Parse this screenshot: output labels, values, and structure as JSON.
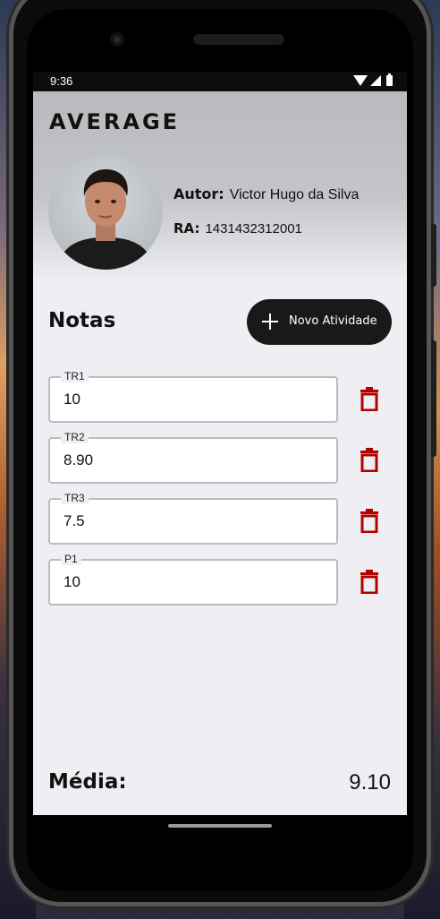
{
  "statusbar": {
    "time": "9:36"
  },
  "header": {
    "title": "AVERAGE",
    "author_label": "Autor:",
    "author_name": "Victor Hugo da Silva",
    "ra_label": "RA:",
    "ra_value": "1431432312001"
  },
  "grades_section": {
    "title": "Notas",
    "add_button_label": "Novo Atividade"
  },
  "grades": [
    {
      "label": "TR1",
      "value": "10"
    },
    {
      "label": "TR2",
      "value": "8.90"
    },
    {
      "label": "TR3",
      "value": "7.5"
    },
    {
      "label": "P1",
      "value": "10"
    }
  ],
  "footer": {
    "media_label": "Média:",
    "media_value": "9.10"
  },
  "colors": {
    "accent": "#191919",
    "delete": "#b00000",
    "background": "#efeff3"
  }
}
